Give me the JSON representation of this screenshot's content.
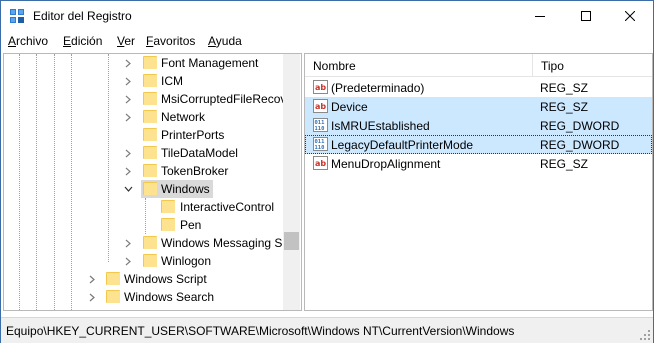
{
  "window": {
    "title": "Editor del Registro"
  },
  "menu": [
    "Archivo",
    "Edición",
    "Ver",
    "Favoritos",
    "Ayuda"
  ],
  "tree": {
    "items": [
      {
        "label": "Font Management",
        "expander": "collapsed"
      },
      {
        "label": "ICM",
        "expander": "collapsed"
      },
      {
        "label": "MsiCorruptedFileRecov",
        "expander": "collapsed"
      },
      {
        "label": "Network",
        "expander": "collapsed"
      },
      {
        "label": "PrinterPorts",
        "expander": "none"
      },
      {
        "label": "TileDataModel",
        "expander": "collapsed"
      },
      {
        "label": "TokenBroker",
        "expander": "collapsed"
      },
      {
        "label": "Windows",
        "expander": "expanded",
        "selected": true
      },
      {
        "label": "InteractiveControl",
        "expander": "none"
      },
      {
        "label": "Pen",
        "expander": "none"
      },
      {
        "label": "Windows Messaging Su",
        "expander": "collapsed"
      },
      {
        "label": "Winlogon",
        "expander": "collapsed"
      },
      {
        "label": "Windows Script",
        "expander": "collapsed"
      },
      {
        "label": "Windows Search",
        "expander": "collapsed"
      }
    ]
  },
  "list": {
    "columns": [
      "Nombre",
      "Tipo"
    ],
    "rows": [
      {
        "name": "(Predeterminado)",
        "type": "REG_SZ",
        "icon": "string-value-icon",
        "state": "normal"
      },
      {
        "name": "Device",
        "type": "REG_SZ",
        "icon": "string-value-icon",
        "state": "selected"
      },
      {
        "name": "IsMRUEstablished",
        "type": "REG_DWORD",
        "icon": "binary-value-icon",
        "state": "selected"
      },
      {
        "name": "LegacyDefaultPrinterMode",
        "type": "REG_DWORD",
        "icon": "binary-value-icon",
        "state": "focused"
      },
      {
        "name": "MenuDropAlignment",
        "type": "REG_SZ",
        "icon": "string-value-icon",
        "state": "normal"
      }
    ]
  },
  "status": {
    "path": "Equipo\\HKEY_CURRENT_USER\\SOFTWARE\\Microsoft\\Windows NT\\CurrentVersion\\Windows"
  },
  "colors": {
    "selection": "#cce8ff",
    "tree_selection": "#d9d9d9",
    "folder": "#f2c94c",
    "string_icon": "#c8342a",
    "binary_icon": "#2f6fb8"
  }
}
